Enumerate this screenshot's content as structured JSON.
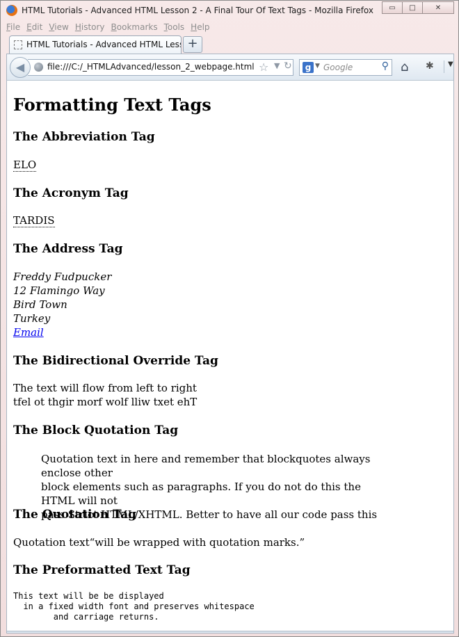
{
  "window": {
    "title": "HTML Tutorials - Advanced HTML Lesson 2 - A Final Tour Of Text Tags - Mozilla Firefox",
    "min_label": "▭",
    "max_label": "□",
    "close_label": "✕"
  },
  "menu": [
    "File",
    "Edit",
    "View",
    "History",
    "Bookmarks",
    "Tools",
    "Help"
  ],
  "tab": {
    "label": "HTML Tutorials - Advanced HTML Lesso...",
    "new_tab_label": "+"
  },
  "navbar": {
    "url": "file:///C:/_HTMLAdvanced/lesson_2_webpage.html",
    "search_placeholder": "Google",
    "search_engine_letter": "g"
  },
  "page": {
    "h1": "Formatting Text Tags",
    "abbr_heading": "The Abbreviation Tag",
    "abbr_text": "ELO",
    "acronym_heading": "The Acronym Tag",
    "acronym_text": "TARDIS",
    "address_heading": "The Address Tag",
    "address_lines": [
      "Freddy Fudpucker",
      "12 Flamingo Way",
      "Bird Town",
      "Turkey"
    ],
    "address_link": "Email",
    "bdo_heading": "The Bidirectional Override Tag",
    "bdo_ltr": "The text will flow from left to right",
    "bdo_rtl": "tfel ot thgir morf wolf lliw txet ehT",
    "blockquote_heading": "The Block Quotation Tag",
    "blockquote_lines": [
      "Quotation text in here and remember that blockquotes always enclose other",
      "block elements such as paragraphs. If you do not do this the HTML will not",
      "pass Strict HTML/XHTML. Better to have all our code pass this"
    ],
    "q_heading": "The Quotation Tag",
    "q_text": "Quotation text“will be wrapped with quotation marks.”",
    "pre_heading": "The Preformatted Text Tag",
    "pre_text": "This text will be be displayed\n  in a fixed width font and preserves whitespace\n        and carriage returns."
  }
}
